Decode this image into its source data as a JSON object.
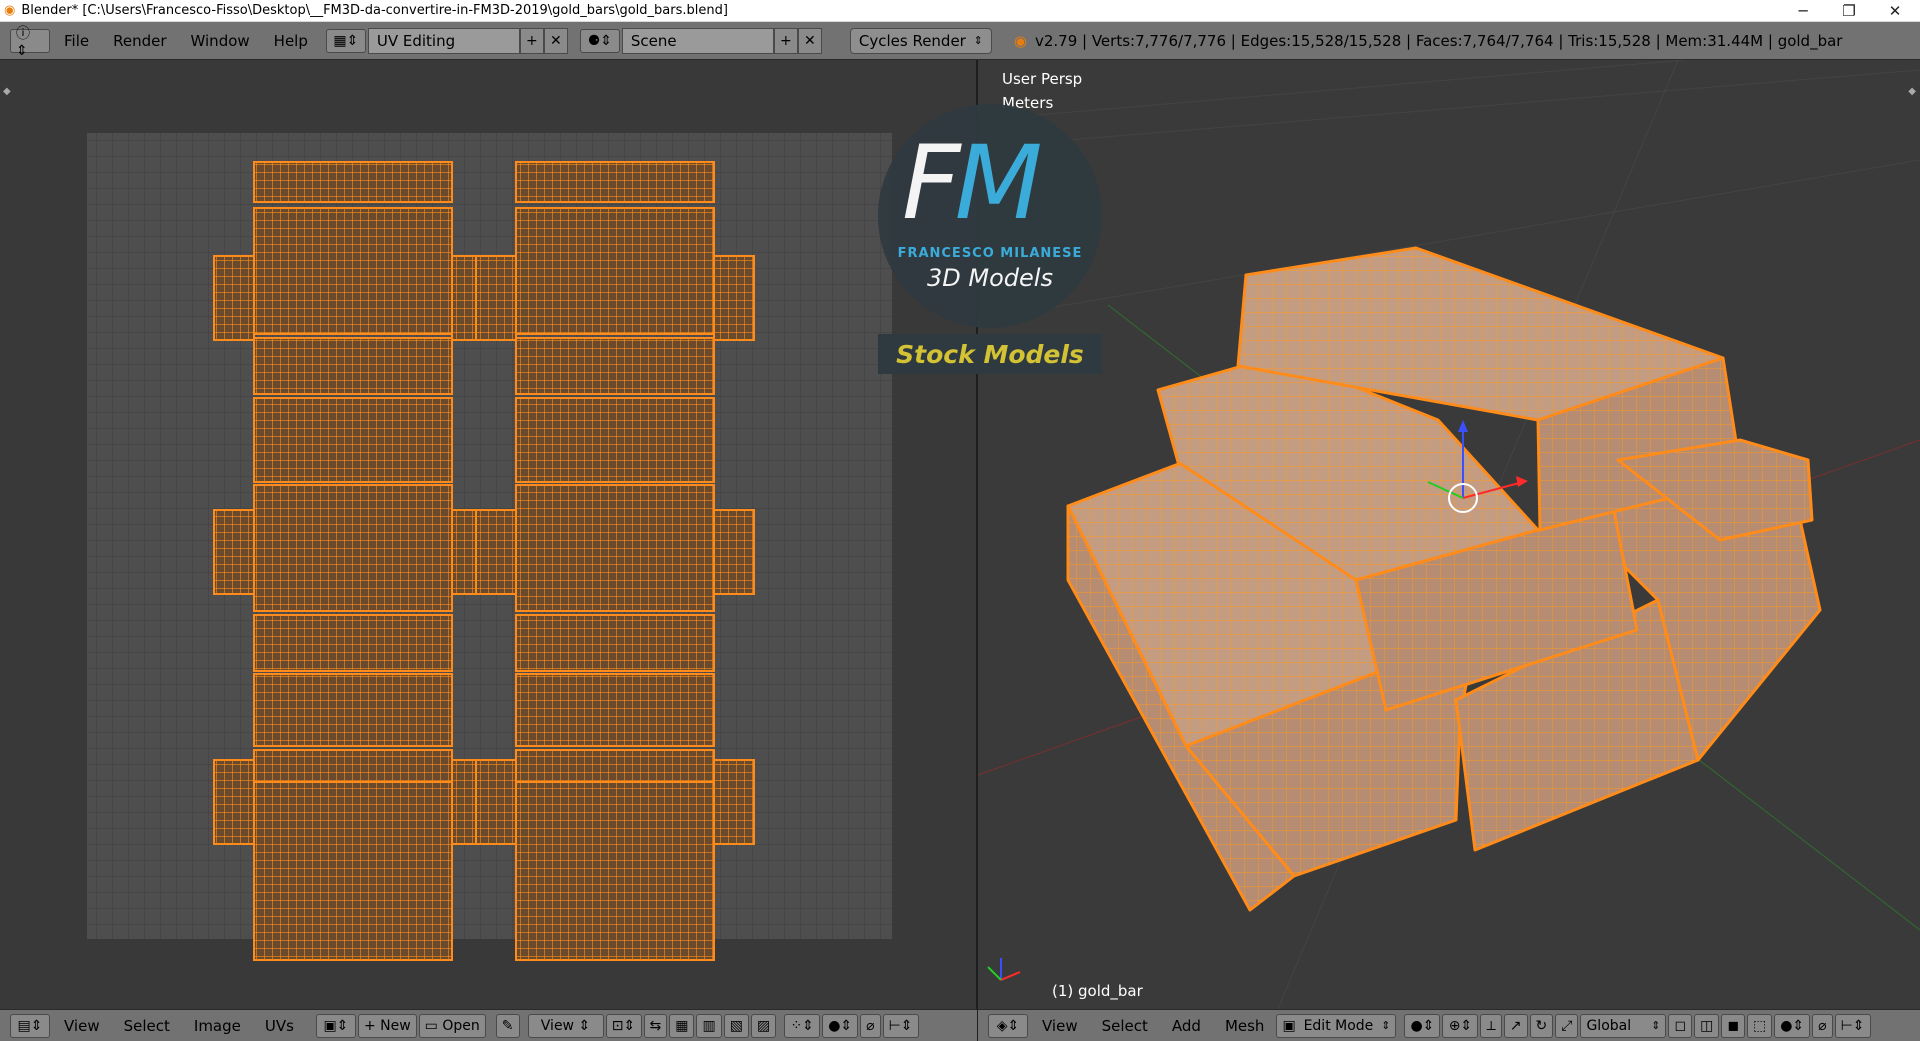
{
  "window": {
    "title": "Blender* [C:\\Users\\Francesco-Fisso\\Desktop\\__FM3D-da-convertire-in-FM3D-2019\\gold_bars\\gold_bars.blend]",
    "minimize": "─",
    "restore": "❐",
    "close": "✕"
  },
  "infobar": {
    "menus": [
      "File",
      "Render",
      "Window",
      "Help"
    ],
    "layout": "UV Editing",
    "scene": "Scene",
    "engine": "Cycles Render",
    "stats": "v2.79 | Verts:7,776/7,776 | Edges:15,528/15,528 | Faces:7,764/7,764 | Tris:15,528 | Mem:31.44M | gold_bar"
  },
  "viewport3d": {
    "view": "User Persp",
    "units": "Meters",
    "object": "(1) gold_bar"
  },
  "uv_bottom": {
    "menus": [
      "View",
      "Select",
      "Image",
      "UVs"
    ],
    "new": "New",
    "open": "Open",
    "view": "View"
  },
  "v3d_bottom": {
    "menus": [
      "View",
      "Select",
      "Add",
      "Mesh"
    ],
    "mode": "Edit Mode",
    "orientation": "Global"
  },
  "logo": {
    "f": "F",
    "m": "M",
    "name": "FRANCESCO MILANESE",
    "sub": "3D Models",
    "stock": "Stock Models"
  },
  "colors": {
    "accent_orange": "#ff8c1a",
    "gold_face": "#c9a589",
    "logo_blue": "#3cb3e3",
    "stock_yellow": "#d4c235"
  }
}
